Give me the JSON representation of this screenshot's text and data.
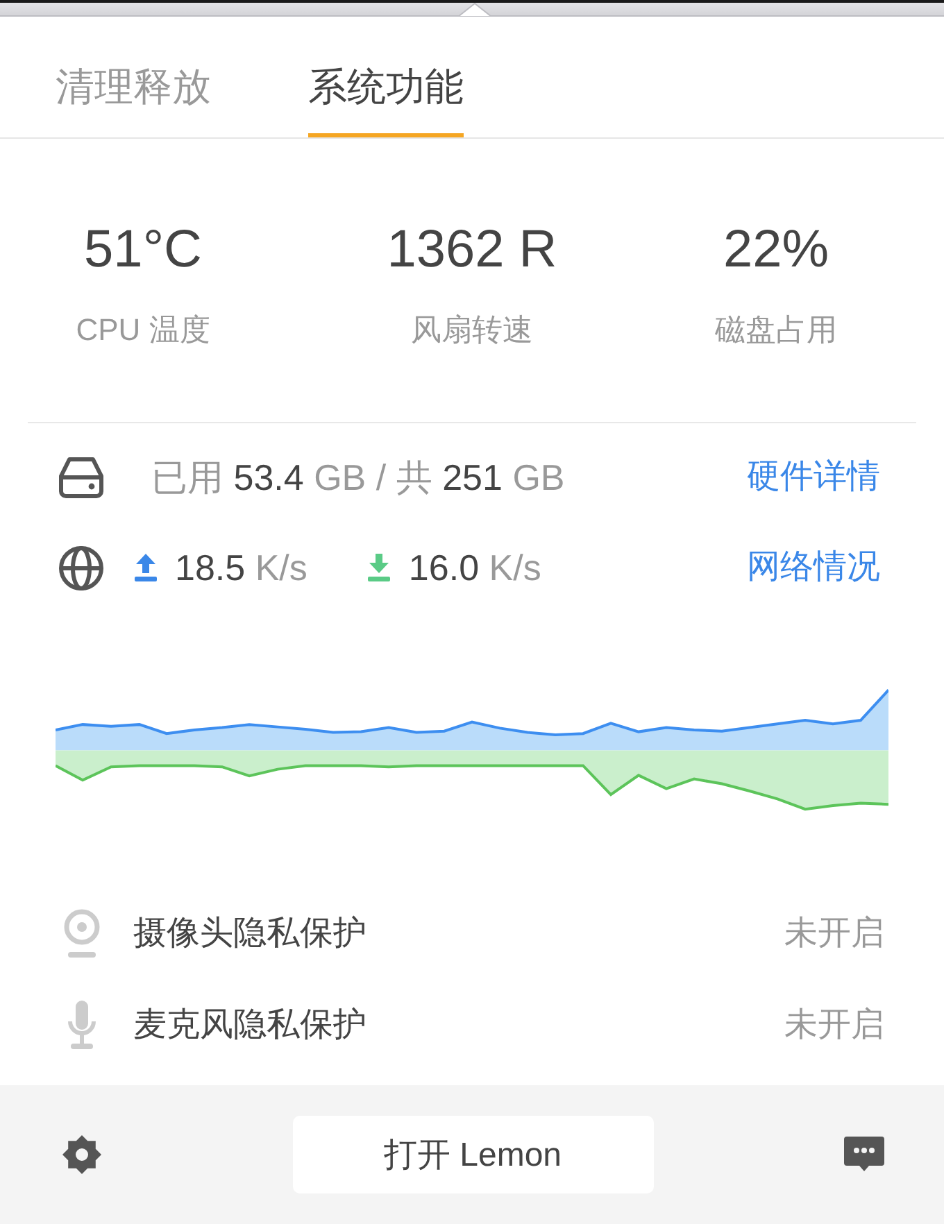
{
  "tabs": [
    {
      "label": "清理释放",
      "selected": false
    },
    {
      "label": "系统功能",
      "selected": true
    }
  ],
  "stats": [
    {
      "value": "51°C",
      "label": "CPU 温度"
    },
    {
      "value": "1362 R",
      "label": "风扇转速"
    },
    {
      "value": "22%",
      "label": "磁盘占用"
    }
  ],
  "disk": {
    "parts": [
      {
        "text": "已用",
        "kind": "label"
      },
      {
        "text": "53.4",
        "kind": "value"
      },
      {
        "text": "GB / 共",
        "kind": "label"
      },
      {
        "text": "251",
        "kind": "value"
      },
      {
        "text": "GB",
        "kind": "label"
      }
    ],
    "link": "硬件详情"
  },
  "network": {
    "upload": {
      "value": "18.5",
      "unit": "K/s"
    },
    "download": {
      "value": "16.0",
      "unit": "K/s"
    },
    "link": "网络情况"
  },
  "privacy": [
    {
      "kind": "camera",
      "label": "摄像头隐私保护",
      "status": "未开启",
      "on": false
    },
    {
      "kind": "microphone",
      "label": "麦克风隐私保护",
      "status": "未开启",
      "on": false
    }
  ],
  "footer": {
    "button": "打开 Lemon"
  }
}
